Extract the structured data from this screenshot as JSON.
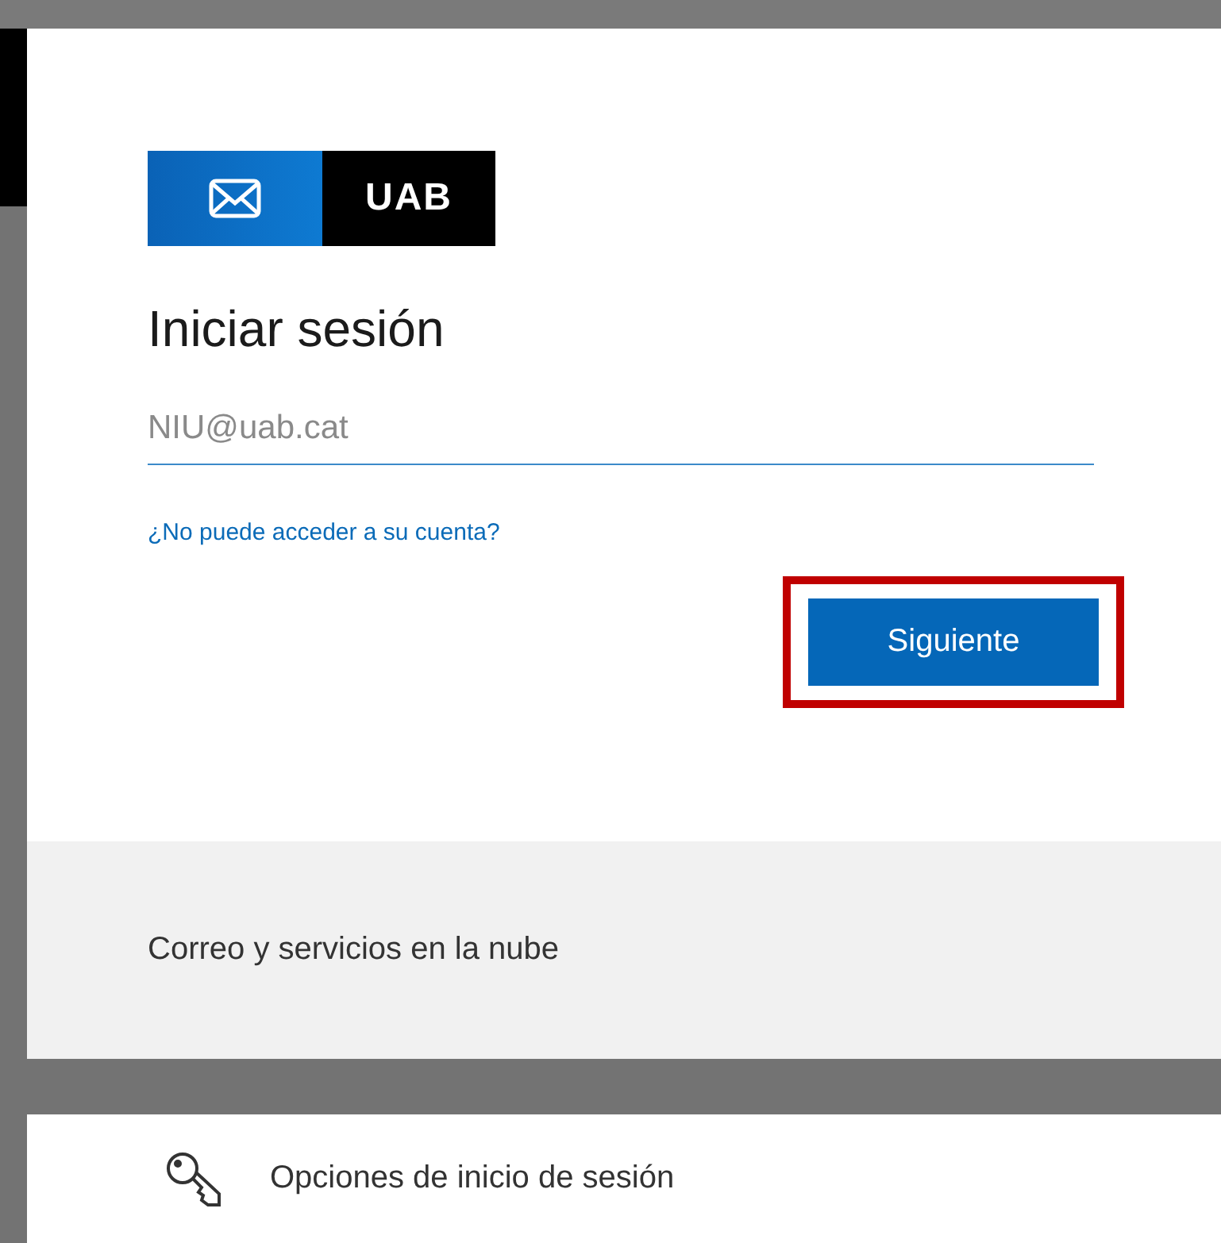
{
  "signin": {
    "logo": {
      "text": "UAB"
    },
    "title": "Iniciar sesión",
    "email_field": {
      "placeholder": "NIU@uab.cat"
    },
    "help_link": "¿No puede acceder a su cuenta?",
    "next_button": {
      "label": "Siguiente",
      "highlighted": true
    },
    "footer_text": "Correo y servicios en la nube"
  },
  "options": {
    "label": "Opciones de inicio de sesión"
  }
}
